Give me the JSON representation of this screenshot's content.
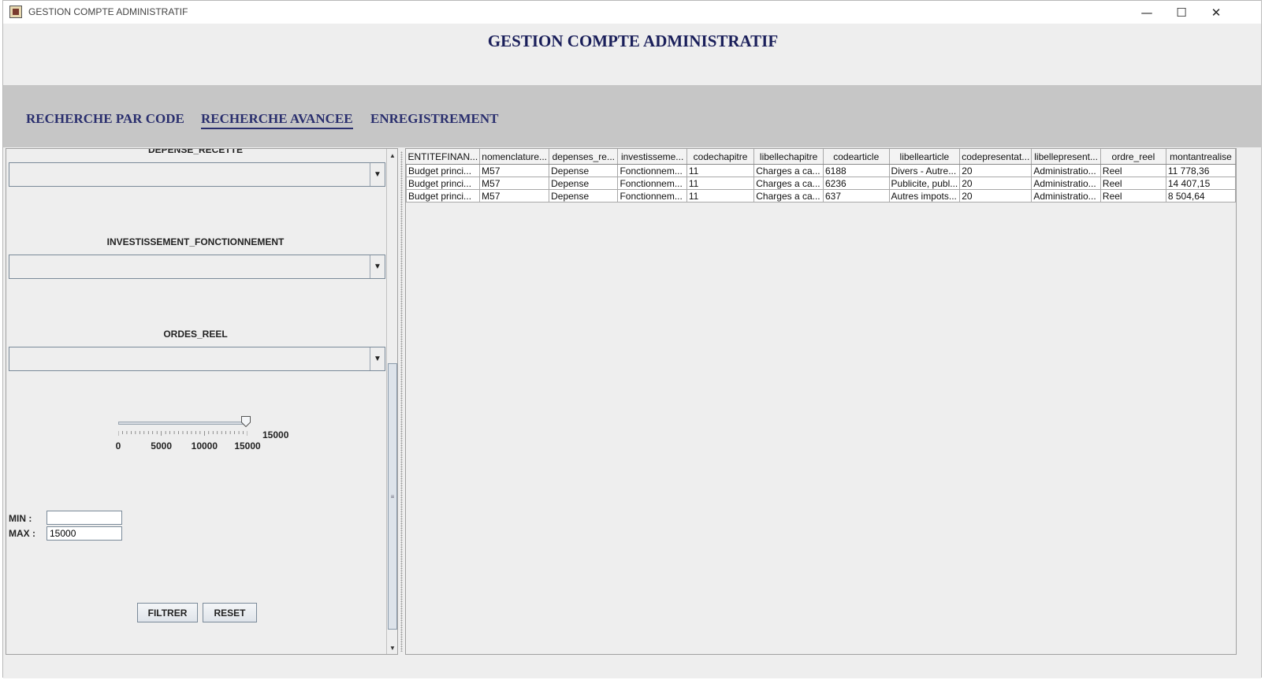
{
  "window": {
    "title": "GESTION COMPTE ADMINISTRATIF",
    "controls": {
      "minimize": "—",
      "maximize": "☐",
      "close": "✕"
    }
  },
  "header": {
    "title": "GESTION COMPTE ADMINISTRATIF"
  },
  "tabs": [
    {
      "label": "RECHERCHE PAR CODE",
      "active": false
    },
    {
      "label": "RECHERCHE AVANCEE",
      "active": true
    },
    {
      "label": "ENREGISTREMENT",
      "active": false
    }
  ],
  "filters": {
    "depense_recette": {
      "label": "DEPENSE_RECETTE",
      "value": ""
    },
    "investissement_fonctionnement": {
      "label": "INVESTISSEMENT_FONCTIONNEMENT",
      "value": ""
    },
    "ordes_reel": {
      "label": "ORDES_REEL",
      "value": ""
    },
    "slider": {
      "min": 0,
      "max": 15000,
      "value": 15000,
      "tick_labels": [
        "0",
        "5000",
        "10000",
        "15000"
      ],
      "value_label": "15000"
    },
    "min_label": "MIN :",
    "max_label": "MAX :",
    "min_value": "",
    "max_value": "15000",
    "filter_button": "FILTRER",
    "reset_button": "RESET"
  },
  "table": {
    "columns": [
      "ENTITEFINAN...",
      "nomenclature...",
      "depenses_re...",
      "investisseme...",
      "codechapitre",
      "libellechapitre",
      "codearticle",
      "libellearticle",
      "codepresentat...",
      "libellepresent...",
      "ordre_reel",
      "montantrealise"
    ],
    "rows": [
      [
        "Budget princi...",
        "M57",
        "Depense",
        "Fonctionnem...",
        "11",
        "Charges a  ca...",
        "6188",
        "Divers - Autre...",
        "20",
        "Administratio...",
        "Reel",
        "11 778,36"
      ],
      [
        "Budget princi...",
        "M57",
        "Depense",
        "Fonctionnem...",
        "11",
        "Charges a  ca...",
        "6236",
        "Publicite, publ...",
        "20",
        "Administratio...",
        "Reel",
        "14 407,15"
      ],
      [
        "Budget princi...",
        "M57",
        "Depense",
        "Fonctionnem...",
        "11",
        "Charges a  ca...",
        "637",
        "Autres impots...",
        "20",
        "Administratio...",
        "Reel",
        "8 504,64"
      ]
    ]
  },
  "colors": {
    "title_text": "#1a1f5a",
    "tab_text": "#2a2f6e",
    "tab_bar": "#c6c6c6",
    "panel_bg": "#eeeeee"
  }
}
